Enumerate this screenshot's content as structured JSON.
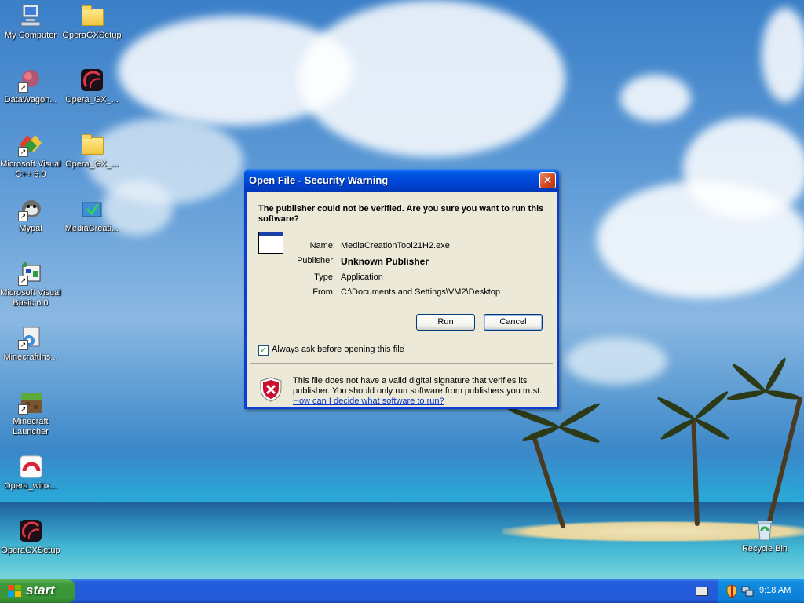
{
  "desktop": {
    "icons": [
      {
        "label": "My Computer"
      },
      {
        "label": "OperaGXSetup"
      },
      {
        "label": "DataWagon..."
      },
      {
        "label": "Opera_GX_..."
      },
      {
        "label": "Microsoft Visual C++ 6.0"
      },
      {
        "label": "Opera_GX_..."
      },
      {
        "label": "Mypal"
      },
      {
        "label": "MediaCreati..."
      },
      {
        "label": "Microsoft Visual Basic 6.0"
      },
      {
        "label": "MinecraftIns..."
      },
      {
        "label": "Minecraft Launcher"
      },
      {
        "label": "Opera_winx..."
      },
      {
        "label": "OperaGXSetup"
      },
      {
        "label": "Recycle Bin"
      }
    ]
  },
  "dialog": {
    "title": "Open File - Security Warning",
    "close_glyph": "✕",
    "headline": "The publisher could not be verified.  Are you sure you want to run this software?",
    "fields": {
      "name_label": "Name:",
      "name_value": "MediaCreationTool21H2.exe",
      "publisher_label": "Publisher:",
      "publisher_value": "Unknown Publisher",
      "type_label": "Type:",
      "type_value": "Application",
      "from_label": "From:",
      "from_value": "C:\\Documents and Settings\\VM2\\Desktop"
    },
    "run_label": "Run",
    "cancel_label": "Cancel",
    "always_ask_label": "Always ask before opening this file",
    "always_ask_checked": true,
    "warning_text": "This file does not have a valid digital signature that verifies its publisher.  You should only run software from publishers you trust.",
    "warning_link": "How can I decide what software to run?"
  },
  "taskbar": {
    "start_label": "start",
    "clock": "9:18 AM"
  },
  "colors": {
    "titlebar": "#0046d8",
    "taskbar": "#245edc",
    "start_button": "#3a9537",
    "dialog_face": "#ece9d8",
    "link": "#0033cc"
  }
}
